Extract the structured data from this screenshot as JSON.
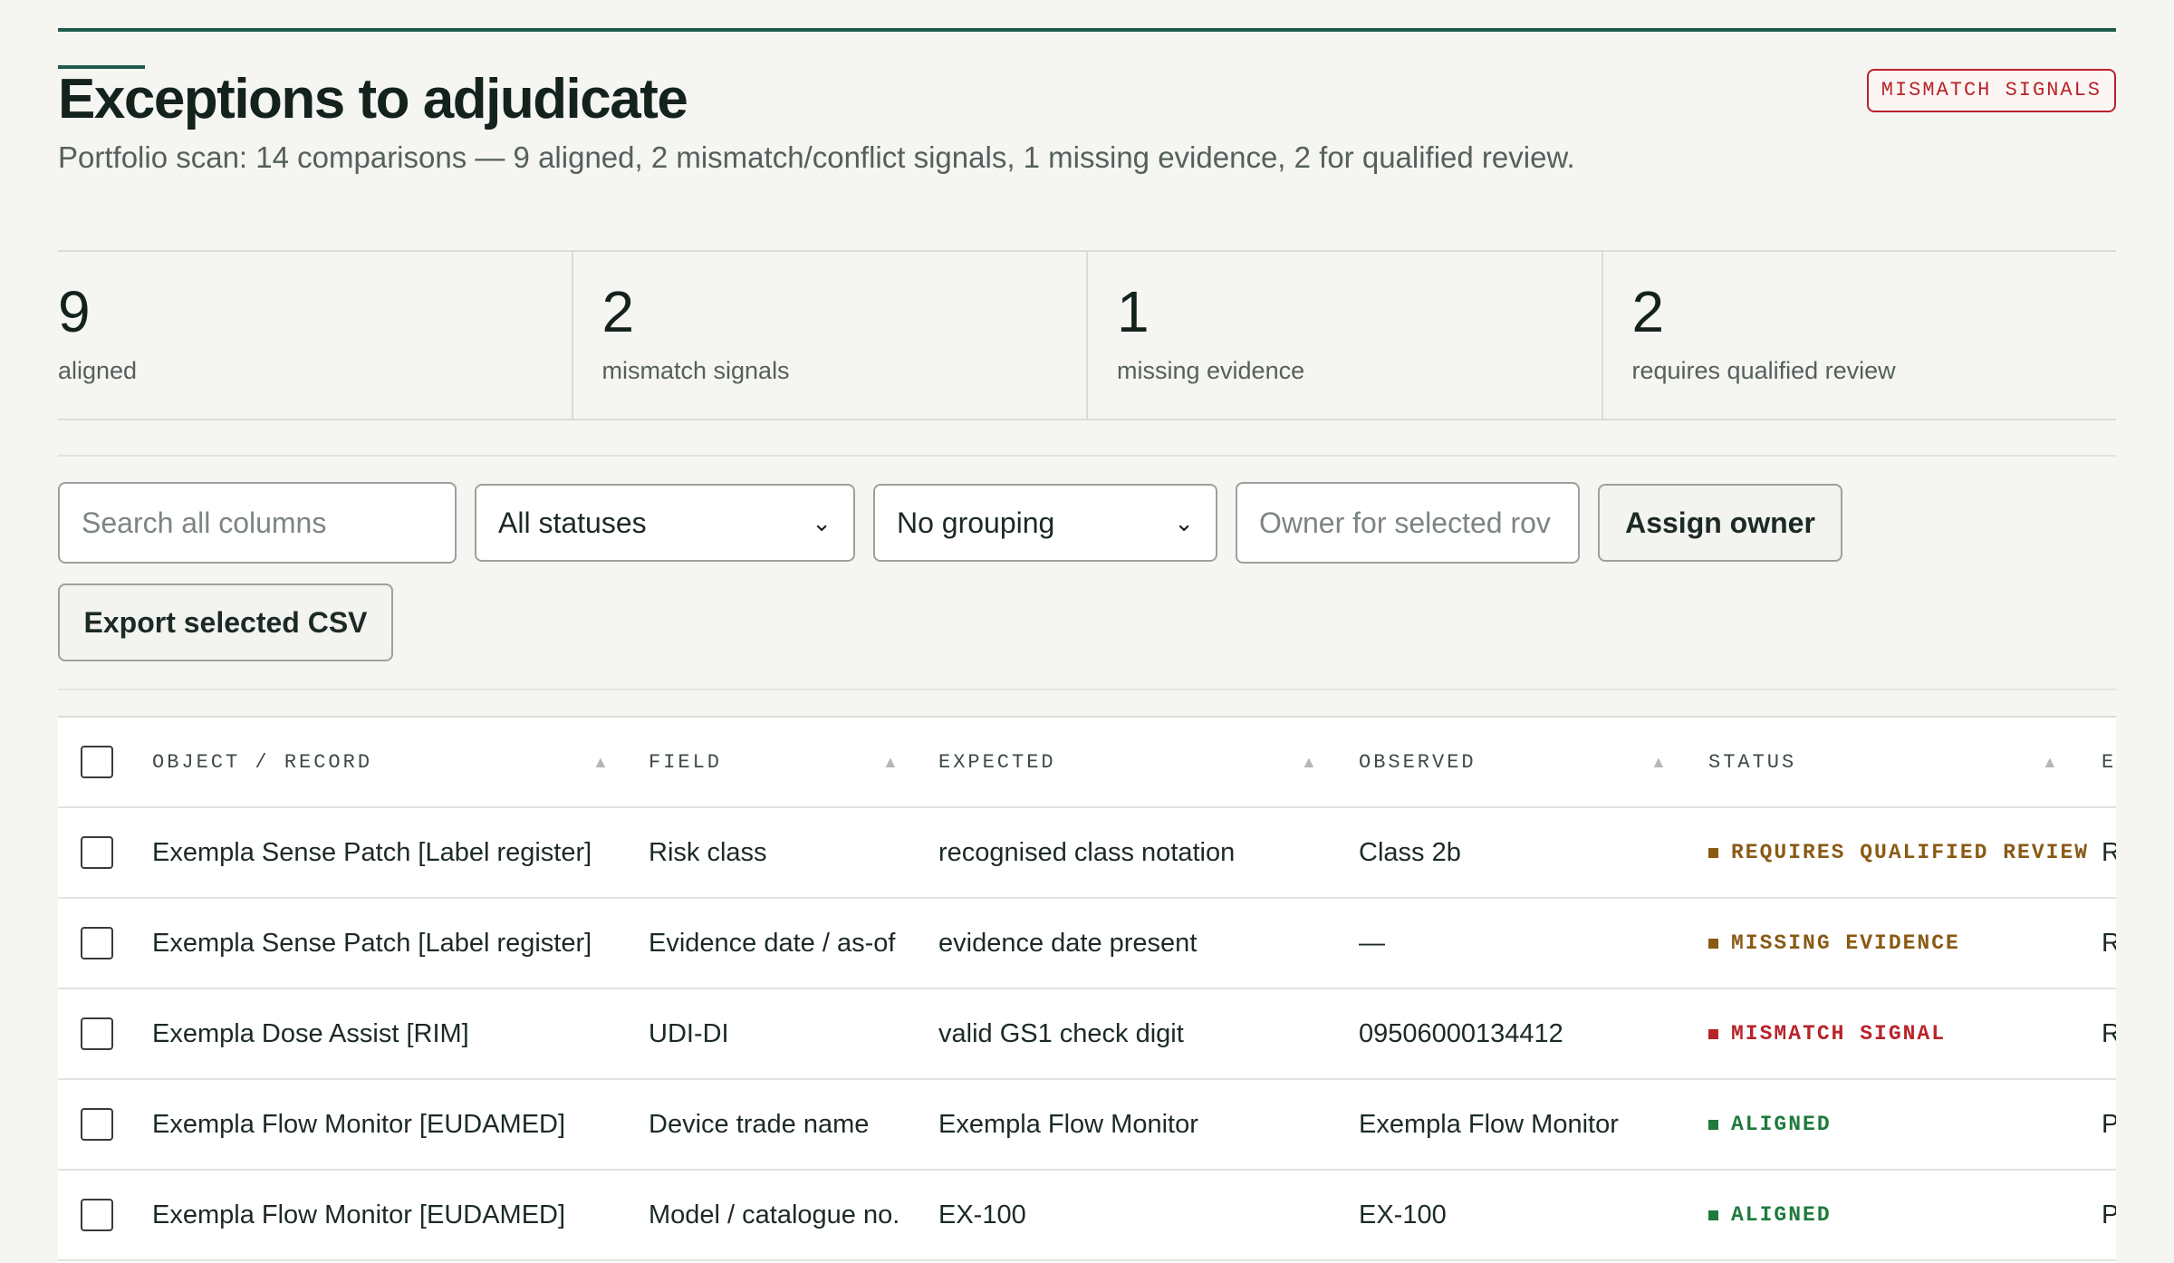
{
  "header": {
    "title": "Exceptions to adjudicate",
    "subtitle": "Portfolio scan: 14 comparisons — 9 aligned, 2 mismatch/conflict signals, 1 missing evidence, 2 for qualified review.",
    "badge": "MISMATCH SIGNALS"
  },
  "summary": [
    {
      "value": "9",
      "label": "aligned"
    },
    {
      "value": "2",
      "label": "mismatch signals"
    },
    {
      "value": "1",
      "label": "missing evidence"
    },
    {
      "value": "2",
      "label": "requires qualified review"
    }
  ],
  "toolbar": {
    "search_placeholder": "Search all columns",
    "status_filter": "All statuses",
    "grouping": "No grouping",
    "owner_placeholder": "Owner for selected rov",
    "assign_label": "Assign owner",
    "export_label": "Export selected CSV"
  },
  "icons": {
    "sort": "sort-ascending-icon",
    "dropdown": "chevron-down-icon"
  },
  "colors": {
    "accent": "#1f5a4c",
    "mismatch": "#b8232a",
    "warning": "#8a5a14",
    "aligned": "#1f7a3c"
  },
  "table": {
    "columns": [
      "OBJECT / RECORD",
      "FIELD",
      "EXPECTED",
      "OBSERVED",
      "STATUS",
      "E"
    ],
    "rows": [
      {
        "object": "Exempla Sense Patch [Label register]",
        "field": "Risk class",
        "expected": "recognised class notation",
        "observed": "Class 2b",
        "status": "REQUIRES QUALIFIED REVIEW",
        "tone": "warning",
        "extra": "R"
      },
      {
        "object": "Exempla Sense Patch [Label register]",
        "field": "Evidence date / as-of",
        "expected": "evidence date present",
        "observed": "—",
        "status": "MISSING EVIDENCE",
        "tone": "warning",
        "extra": "R"
      },
      {
        "object": "Exempla Dose Assist [RIM]",
        "field": "UDI-DI",
        "expected": "valid GS1 check digit",
        "observed": "09506000134412",
        "status": "MISMATCH SIGNAL",
        "tone": "mismatch",
        "extra": "R"
      },
      {
        "object": "Exempla Flow Monitor [EUDAMED]",
        "field": "Device trade name",
        "expected": "Exempla Flow Monitor",
        "observed": "Exempla Flow Monitor",
        "status": "ALIGNED",
        "tone": "aligned",
        "extra": "P"
      },
      {
        "object": "Exempla Flow Monitor [EUDAMED]",
        "field": "Model / catalogue no.",
        "expected": "EX-100",
        "observed": "EX-100",
        "status": "ALIGNED",
        "tone": "aligned",
        "extra": "P"
      }
    ]
  }
}
